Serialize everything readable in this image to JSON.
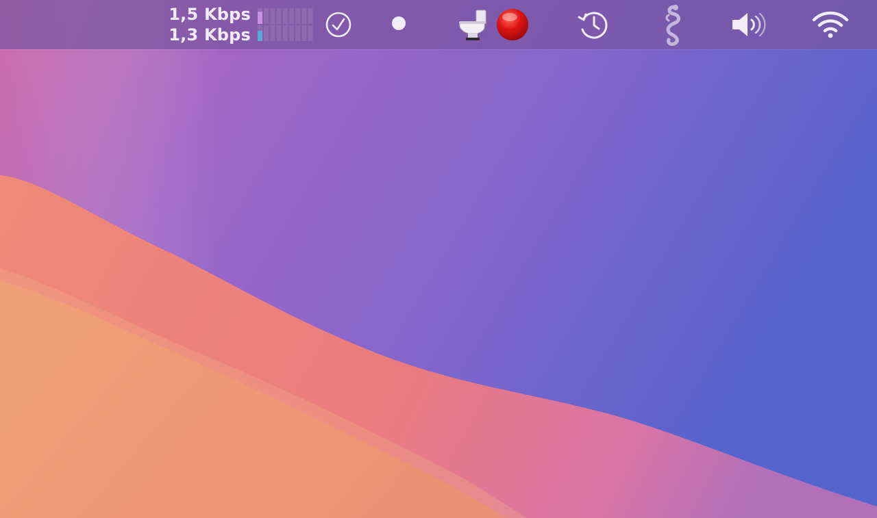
{
  "menubar": {
    "network": {
      "upload_speed": "1,5 Kbps",
      "download_speed": "1,3 Kbps",
      "upload_level": 0.3,
      "download_level": 0.25,
      "upload_color": "#c98fe0",
      "download_color": "#5aa9d8"
    },
    "icons": {
      "checkmark": "checkmark-circle-icon",
      "dot": "dot-icon",
      "toilet": "toilet-icon",
      "record": "red-record-icon",
      "time_machine": "clock-history-icon",
      "snake": "snake-icon",
      "volume": "speaker-volume-icon",
      "wifi": "wifi-icon"
    },
    "colors": {
      "icon": "#f1ecf6",
      "record": "#e01515"
    }
  },
  "wallpaper": {
    "colors": {
      "sky_top_left": "#c069b8",
      "sky_mid": "#9466c8",
      "sky_right": "#5a64cc",
      "dune_front": "#ee9a73",
      "dune_back": "#ea7f7c"
    }
  }
}
